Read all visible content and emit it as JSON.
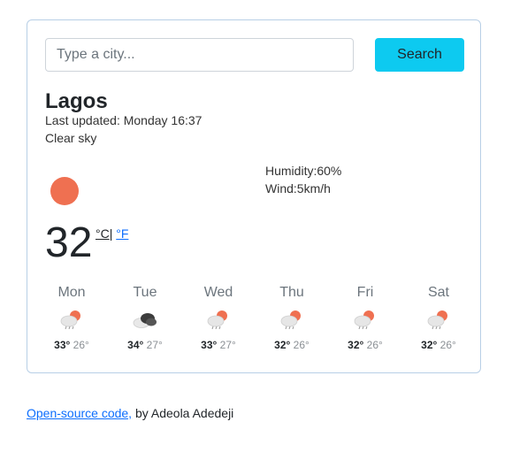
{
  "search": {
    "placeholder": "Type a city...",
    "button_label": "Search"
  },
  "current": {
    "city": "Lagos",
    "last_updated": "Last updated: Monday 16:37",
    "description": "Clear sky",
    "icon": "sun-icon",
    "temperature": "32",
    "unit_celsius": "°C",
    "unit_separator": "|",
    "unit_fahrenheit": "°F",
    "humidity": "Humidity:60%",
    "wind": "Wind:5km/h"
  },
  "forecast": [
    {
      "day": "Mon",
      "icon": "sun-cloud-rain-icon",
      "max": "33°",
      "min": "26°"
    },
    {
      "day": "Tue",
      "icon": "dark-cloud-icon",
      "max": "34°",
      "min": "27°"
    },
    {
      "day": "Wed",
      "icon": "sun-cloud-rain-icon",
      "max": "33°",
      "min": "27°"
    },
    {
      "day": "Thu",
      "icon": "sun-cloud-rain-icon",
      "max": "32°",
      "min": "26°"
    },
    {
      "day": "Fri",
      "icon": "sun-cloud-rain-icon",
      "max": "32°",
      "min": "26°"
    },
    {
      "day": "Sat",
      "icon": "sun-cloud-rain-icon",
      "max": "32°",
      "min": "26°"
    }
  ],
  "footer": {
    "link_text": "Open-source code,",
    "author_text": " by Adeola Adedeji"
  },
  "colors": {
    "accent": "#0dcaf0",
    "sun": "#ef7051",
    "link": "#0d6efd",
    "card_border": "#b8cfe6"
  }
}
